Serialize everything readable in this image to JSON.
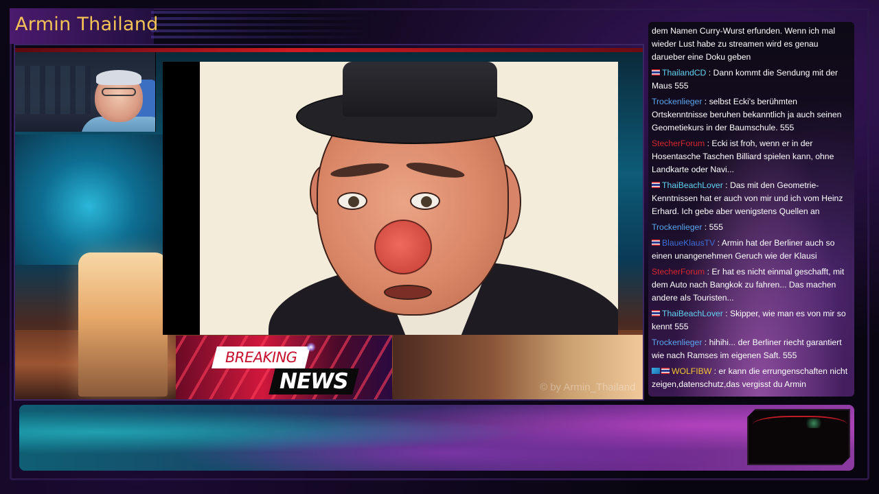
{
  "channel": {
    "title": "Armin Thailand",
    "watermark": "© by Armin_Thailand"
  },
  "lower_third": {
    "line1": "BREAKING",
    "line2": "NEWS"
  },
  "chat": {
    "messages": [
      {
        "user": "",
        "user_color": "#ffffff",
        "flag": "",
        "text": "dem Namen Curry-Wurst erfunden. Wenn ich mal wieder Lust habe zu streamen wird es genau darueber eine Doku geben"
      },
      {
        "user": "ThailandCD",
        "user_color": "#62d3f2",
        "flag": "th",
        "text": "Dann kommt die Sendung mit der Maus 555"
      },
      {
        "user": "Trockenlieger",
        "user_color": "#5aa6f0",
        "flag": "",
        "text": "selbst Ecki's berühmten Ortskenntnisse beruhen bekanntlich ja auch seinen Geometiekurs in der Baumschule. 555"
      },
      {
        "user": "StecherForum",
        "user_color": "#d8262e",
        "flag": "",
        "text": "Ecki ist froh, wenn er in der Hosentasche Taschen Billiard spielen kann, ohne Landkarte oder Navi..."
      },
      {
        "user": "ThaiBeachLover",
        "user_color": "#62d3f2",
        "flag": "th",
        "text": "Das mit den Geometrie-Kenntnissen hat er auch von mir und ich vom Heinz Erhard. Ich gebe aber wenigstens Quellen an"
      },
      {
        "user": "Trockenlieger",
        "user_color": "#5aa6f0",
        "flag": "",
        "text": "555"
      },
      {
        "user": "BlaueKlausTV",
        "user_color": "#3f6fd8",
        "flag": "th",
        "text": "Armin hat der Berliner auch so einen unangenehmen Geruch wie der Klausi"
      },
      {
        "user": "StecherForum",
        "user_color": "#d8262e",
        "flag": "",
        "text": "Er hat es nicht einmal geschafft, mit dem Auto nach Bangkok zu fahren... Das machen andere als Touristen..."
      },
      {
        "user": "ThaiBeachLover",
        "user_color": "#62d3f2",
        "flag": "th",
        "text": "Skipper, wie man es von mir so kennt 555"
      },
      {
        "user": "Trockenlieger",
        "user_color": "#5aa6f0",
        "flag": "",
        "text": "hihihi... der Berliner riecht garantiert wie nach Ramses im eigenen Saft. 555"
      },
      {
        "user": "WOLFIBW",
        "user_color": "#f2c530",
        "flag": "mixed",
        "text": "er kann die errungenschaften nicht zeigen,datenschutz,das vergisst du Armin"
      }
    ]
  }
}
